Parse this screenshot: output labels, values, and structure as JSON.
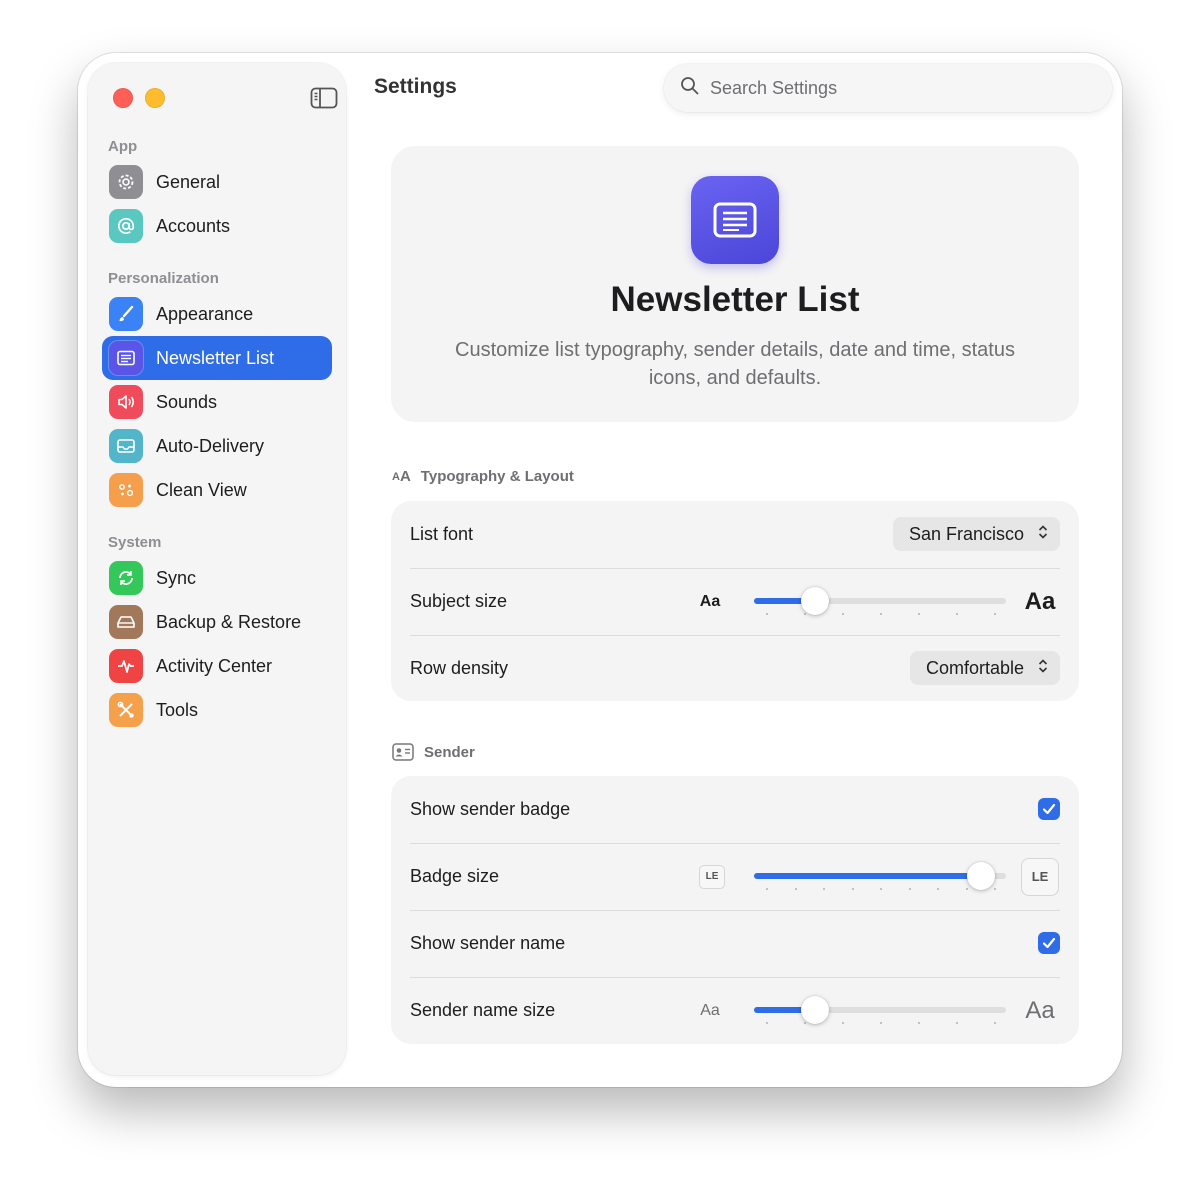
{
  "window": {
    "title": "Settings",
    "search": {
      "placeholder": "Search Settings",
      "icon": "magnifier-icon"
    }
  },
  "sidebar": {
    "sections": [
      {
        "title": "App",
        "items": [
          {
            "label": "General",
            "icon": "gear-icon",
            "color": "#8e8e93"
          },
          {
            "label": "Accounts",
            "icon": "at-sign-icon",
            "color": "#5ac8c0"
          }
        ]
      },
      {
        "title": "Personalization",
        "items": [
          {
            "label": "Appearance",
            "icon": "paintbrush-icon",
            "color": "#3b82f6"
          },
          {
            "label": "Newsletter List",
            "icon": "list-icon",
            "color": "#5a55e6",
            "selected": true
          },
          {
            "label": "Sounds",
            "icon": "speaker-icon",
            "color": "#ef4b5a"
          },
          {
            "label": "Auto-Delivery",
            "icon": "inbox-icon",
            "color": "#52b5c9"
          },
          {
            "label": "Clean View",
            "icon": "sparkles-icon",
            "color": "#f59e4b"
          }
        ]
      },
      {
        "title": "System",
        "items": [
          {
            "label": "Sync",
            "icon": "sync-icon",
            "color": "#34c759"
          },
          {
            "label": "Backup & Restore",
            "icon": "drive-icon",
            "color": "#a2785a"
          },
          {
            "label": "Activity Center",
            "icon": "waveform-icon",
            "color": "#f04444"
          },
          {
            "label": "Tools",
            "icon": "wrench-icon",
            "color": "#f5a04b"
          }
        ]
      }
    ]
  },
  "hero": {
    "title": "Newsletter List",
    "description": "Customize list typography, sender details, date and time, status icons, and defaults.",
    "icon": "list-icon"
  },
  "typography": {
    "group_title": "Typography & Layout",
    "group_icon_text": "AA",
    "list_font": {
      "label": "List font",
      "value": "San Francisco"
    },
    "subject_size": {
      "label": "Subject size",
      "min_label": "Aa",
      "max_label": "Aa",
      "level": 0.21,
      "ticks": 7
    },
    "row_density": {
      "label": "Row density",
      "value": "Comfortable"
    }
  },
  "sender": {
    "group_title": "Sender",
    "group_icon": "contact-card-icon",
    "show_badge": {
      "label": "Show sender badge",
      "checked": true
    },
    "badge_size": {
      "label": "Badge size",
      "min_label": "LE",
      "max_label": "LE",
      "level": 0.95,
      "ticks": 9
    },
    "show_name": {
      "label": "Show sender name",
      "checked": true
    },
    "name_size": {
      "label": "Sender name size",
      "min_label": "Aa",
      "max_label": "Aa",
      "level": 0.21,
      "ticks": 7
    }
  },
  "colors": {
    "accent": "#2f6ce8",
    "hero_icon": "#5a55e6"
  }
}
